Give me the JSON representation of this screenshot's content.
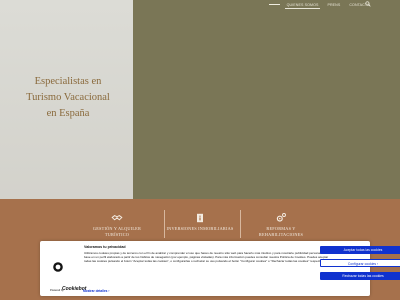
{
  "nav": {
    "items": [
      "QUIENES SOMOS",
      "PRENS",
      "CONTACTO"
    ],
    "active_index": 0
  },
  "hero": {
    "headline_lines": [
      "Especialistas en",
      "Turismo Vacacional",
      "en España"
    ]
  },
  "services": [
    {
      "icon": "handshake-icon",
      "title": "GESTIÓN Y ALQUILER\nTURÍSTICO"
    },
    {
      "icon": "document-icon",
      "title": "INVERSIONES INMOBILIARIAS"
    },
    {
      "icon": "gears-icon",
      "title": "REFORMAS Y\nREHABILITACIONES"
    }
  ],
  "cookie": {
    "title": "Valoramos tu privacidad",
    "text_main": "Utilizamos cookies propias y de terceros con el fin de analizar y comprender el uso que haces de nuestro sitio web para hacerlo más intuitivo y para mostrarte publicidad personalizada con base en un perfil elaborado a partir de tus hábitos de navegación (por ejemplo, páginas visitadas). Para más información puedes consultar nuestra Política de Cookies. Puedes aceptar todas las cookies pulsando el botón \"Aceptar todas las cookies\", o configurarlas o rechazar su uso pulsando el botón \"Configurar cookies\" o \"Rechazar todas las cookies\" respectivamente.",
    "btn_accept": "Aceptar todas las cookies",
    "btn_configure": "Configurar cookies ›",
    "btn_reject": "Rechazar todas las cookies",
    "powered_by": "Powered by",
    "brand": "Cookiebot",
    "show_details": "Mostrar detalles ›"
  },
  "colors": {
    "hero_left": "#dcdcd6",
    "hero_right": "#7a7656",
    "headline": "#8a6a3c",
    "services_bg": "#a6714c",
    "accent_button": "#1032cf"
  }
}
